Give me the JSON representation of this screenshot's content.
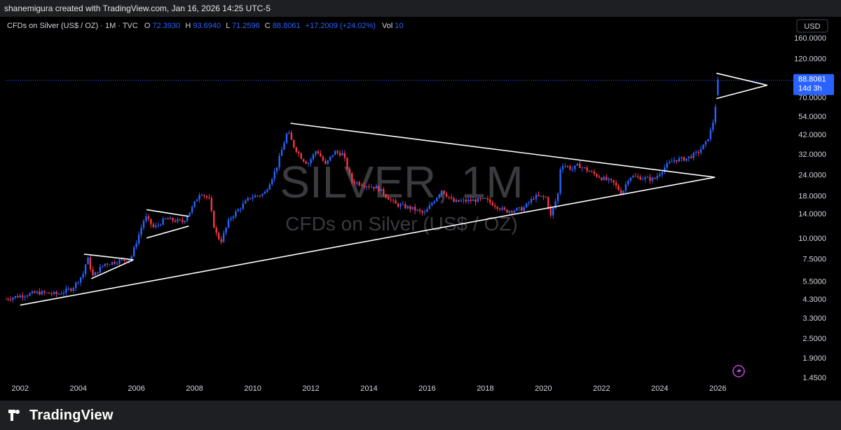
{
  "header": {
    "credit": "shanemigura created with TradingView.com, Jan 16, 2026 14:25 UTC-5"
  },
  "legend": {
    "symbol": "CFDs on Silver (US$ / OZ) · 1M · TVC",
    "o_label": "O",
    "o_value": "72.3930",
    "h_label": "H",
    "h_value": "93.6940",
    "l_label": "L",
    "l_value": "71.2596",
    "c_label": "C",
    "c_value": "88.8061",
    "change": "+17.2009 (+24.02%)",
    "vol_label": "Vol",
    "vol_value": "10"
  },
  "currency_button": "USD",
  "watermark": {
    "title": "SILVER, 1M",
    "subtitle": "CFDs on Silver (US$ / OZ)"
  },
  "price_tag": {
    "value": "88.8061",
    "countdown": "14d 3h"
  },
  "footer": {
    "brand": "TradingView"
  },
  "colors": {
    "up": "#2962ff",
    "down": "#f23645",
    "background": "#000000",
    "text": "#d1d4dc",
    "trendline": "#ffffff",
    "price_tag": "#2962ff"
  },
  "chart_data": {
    "type": "candlestick",
    "scale": "log",
    "interval": "1M",
    "ylim": [
      1.45,
      160
    ],
    "xlim": [
      2001.5,
      2028.5
    ],
    "y_ticks": [
      160,
      120,
      70,
      54,
      42,
      32,
      24,
      18,
      14,
      10,
      7.5,
      5.5,
      4.3,
      3.3,
      2.5,
      1.9,
      1.45
    ],
    "y_tick_labels": [
      "160.0000",
      "120.0000",
      "70.0000",
      "54.0000",
      "42.0000",
      "32.0000",
      "24.0000",
      "18.0000",
      "14.0000",
      "10.0000",
      "7.5000",
      "5.5000",
      "4.3000",
      "3.3000",
      "2.5000",
      "1.9000",
      "1.4500"
    ],
    "x_ticks": [
      "2002",
      "2004",
      "2006",
      "2008",
      "2010",
      "2012",
      "2014",
      "2016",
      "2018",
      "2020",
      "2022",
      "2024",
      "2026"
    ],
    "last_close": 88.8061,
    "monthly_close_anchors": [
      [
        2001.5,
        4.3
      ],
      [
        2002.0,
        4.5
      ],
      [
        2002.6,
        4.7
      ],
      [
        2003.3,
        4.6
      ],
      [
        2003.8,
        5.0
      ],
      [
        2004.2,
        6.2
      ],
      [
        2004.3,
        7.8
      ],
      [
        2004.5,
        5.9
      ],
      [
        2004.9,
        7.0
      ],
      [
        2005.3,
        7.2
      ],
      [
        2005.8,
        7.5
      ],
      [
        2006.0,
        9.5
      ],
      [
        2006.3,
        13.5
      ],
      [
        2006.6,
        11.5
      ],
      [
        2007.0,
        13.0
      ],
      [
        2007.6,
        12.5
      ],
      [
        2007.9,
        15.0
      ],
      [
        2008.2,
        19.0
      ],
      [
        2008.5,
        17.0
      ],
      [
        2008.7,
        11.0
      ],
      [
        2008.9,
        9.5
      ],
      [
        2009.2,
        13.0
      ],
      [
        2009.9,
        17.5
      ],
      [
        2010.4,
        18.5
      ],
      [
        2010.8,
        26.0
      ],
      [
        2011.2,
        44.0
      ],
      [
        2011.4,
        36.0
      ],
      [
        2011.7,
        30.0
      ],
      [
        2011.9,
        28.0
      ],
      [
        2012.2,
        34.0
      ],
      [
        2012.5,
        27.5
      ],
      [
        2012.8,
        33.0
      ],
      [
        2013.1,
        32.0
      ],
      [
        2013.4,
        22.0
      ],
      [
        2013.8,
        21.0
      ],
      [
        2014.3,
        20.0
      ],
      [
        2014.9,
        16.0
      ],
      [
        2015.5,
        15.0
      ],
      [
        2015.9,
        14.0
      ],
      [
        2016.5,
        19.5
      ],
      [
        2016.9,
        16.5
      ],
      [
        2017.5,
        16.8
      ],
      [
        2018.0,
        17.0
      ],
      [
        2018.7,
        14.5
      ],
      [
        2019.3,
        15.0
      ],
      [
        2019.7,
        17.8
      ],
      [
        2020.1,
        17.5
      ],
      [
        2020.25,
        13.5
      ],
      [
        2020.5,
        18.5
      ],
      [
        2020.6,
        28.0
      ],
      [
        2021.0,
        26.0
      ],
      [
        2021.2,
        27.5
      ],
      [
        2021.6,
        25.0
      ],
      [
        2022.0,
        23.0
      ],
      [
        2022.4,
        21.5
      ],
      [
        2022.7,
        18.5
      ],
      [
        2022.95,
        23.5
      ],
      [
        2023.4,
        23.0
      ],
      [
        2023.8,
        22.5
      ],
      [
        2024.2,
        27.0
      ],
      [
        2024.5,
        29.5
      ],
      [
        2024.9,
        30.0
      ],
      [
        2025.3,
        32.5
      ],
      [
        2025.6,
        37.5
      ],
      [
        2025.8,
        46.5
      ],
      [
        2025.9,
        58.0
      ],
      [
        2025.95,
        72.4
      ],
      [
        2026.04,
        88.8061
      ]
    ]
  }
}
